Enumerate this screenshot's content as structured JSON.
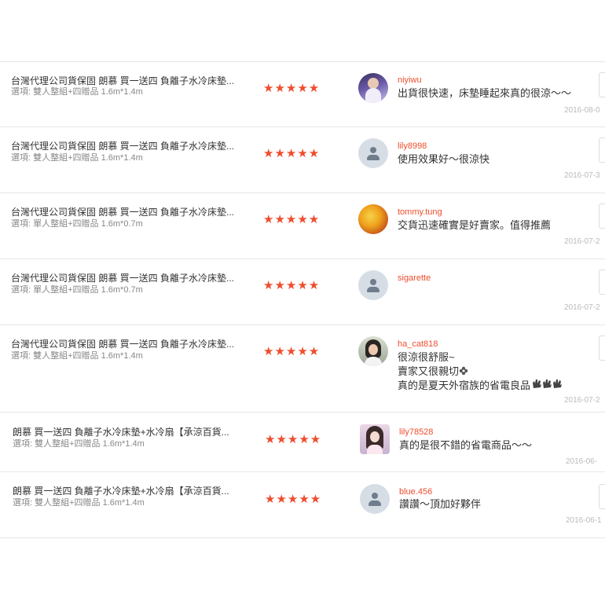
{
  "reviews": [
    {
      "product": "台灣代理公司貨保固 朗慕 買一送四 負離子水冷床墊...",
      "option": "選項: 雙人整組+四贈品 1.6m*1.4m",
      "stars": "★★★★★",
      "rating": 5,
      "username": "niyiwu",
      "avatar": "photo-avatar",
      "comment": [
        "出貨很快速，床墊睡起來真的很涼～～"
      ],
      "date": "2016-08-0"
    },
    {
      "product": "台灣代理公司貨保固 朗慕 買一送四 負離子水冷床墊...",
      "option": "選項: 雙人整組+四贈品 1.6m*1.4m",
      "stars": "★★★★★",
      "rating": 5,
      "username": "lily8998",
      "avatar": "default-user-avatar",
      "comment": [
        "使用效果好～很涼快"
      ],
      "date": "2016-07-3"
    },
    {
      "product": "台灣代理公司貨保固 朗慕 買一送四 負離子水冷床墊...",
      "option": "選項: 單人整組+四贈品 1.6m*0.7m",
      "stars": "★★★★★",
      "rating": 5,
      "username": "tommy.tung",
      "avatar": "photo-avatar",
      "comment": [
        "交貨迅速確實是好賣家。值得推薦"
      ],
      "date": "2016-07-2"
    },
    {
      "product": "台灣代理公司貨保固 朗慕 買一送四 負離子水冷床墊...",
      "option": "選項: 單人整組+四贈品 1.6m*0.7m",
      "stars": "★★★★★",
      "rating": 5,
      "username": "sigarette",
      "avatar": "default-user-avatar",
      "comment": [],
      "date": "2016-07-2"
    },
    {
      "product": "台灣代理公司貨保固 朗慕 買一送四 負離子水冷床墊...",
      "option": "選項: 雙人整組+四贈品 1.6m*1.4m",
      "stars": "★★★★★",
      "rating": 5,
      "username": "ha_cat818",
      "avatar": "photo-avatar",
      "comment": [
        "很涼很舒服~",
        "賣家又很親切",
        "真的是夏天外宿族的省電良品"
      ],
      "date": "2016-07-2"
    },
    {
      "product": "朗慕 買一送四 負離子水冷床墊+水冷扇【承涼百貨...",
      "option": "選項: 雙人整組+四贈品 1.6m*1.4m",
      "stars": "★★★★★",
      "rating": 5,
      "username": "lily78528",
      "avatar": "photo-avatar",
      "comment": [
        "真的是很不錯的省電商品～～"
      ],
      "date": "2016-06-"
    },
    {
      "product": "朗慕 買一送四 負離子水冷床墊+水冷扇【承涼百貨...",
      "option": "選項: 雙人整組+四贈品 1.6m*1.4m",
      "stars": "★★★★★",
      "rating": 5,
      "username": "blue.456",
      "avatar": "default-user-avatar",
      "comment": [
        "讚讚～頂加好夥伴"
      ],
      "date": "2016-06-1"
    }
  ],
  "colors": {
    "accent": "#ee4d2d",
    "divider": "#e8e8e8",
    "muted": "#888888",
    "date": "#bbbbbb"
  }
}
